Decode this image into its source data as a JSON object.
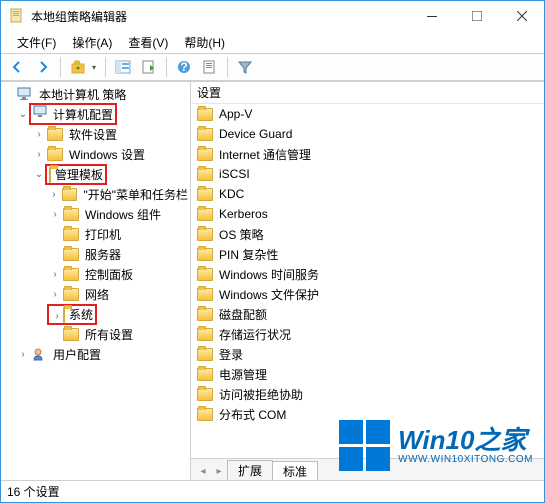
{
  "title": "本地组策略编辑器",
  "menu": [
    "文件(F)",
    "操作(A)",
    "查看(V)",
    "帮助(H)"
  ],
  "toolbar_icons": [
    "back",
    "forward",
    "up",
    "console",
    "export",
    "help",
    "properties",
    "filter"
  ],
  "tree": {
    "root": "本地计算机 策略",
    "computer_config": "计算机配置",
    "software": "软件设置",
    "windows_settings": "Windows 设置",
    "admin_templates": "管理模板",
    "start_menu": "\"开始\"菜单和任务栏",
    "win_components": "Windows 组件",
    "printers": "打印机",
    "servers": "服务器",
    "control_panel": "控制面板",
    "network": "网络",
    "system": "系统",
    "all_settings": "所有设置",
    "user_config": "用户配置"
  },
  "right_header": "设置",
  "right_items": [
    "App-V",
    "Device Guard",
    "Internet 通信管理",
    "iSCSI",
    "KDC",
    "Kerberos",
    "OS 策略",
    "PIN 复杂性",
    "Windows 时间服务",
    "Windows 文件保护",
    "磁盘配额",
    "存储运行状况",
    "登录",
    "电源管理",
    "访问被拒绝协助",
    "分布式 COM"
  ],
  "tabs": [
    "扩展",
    "标准"
  ],
  "status": "16 个设置",
  "watermark": {
    "line1": "Win10之家",
    "line2": "WWW.WIN10XITONG.COM"
  }
}
